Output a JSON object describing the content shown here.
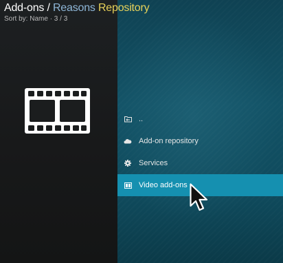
{
  "header": {
    "crumb_addons": "Add-ons",
    "crumb_separator": " / ",
    "crumb_reasons": "Reasons",
    "crumb_repository": " Repository",
    "sort_info": "Sort by: Name  ·  3 / 3"
  },
  "list": {
    "items": [
      {
        "label": "..",
        "icon": "folder-back-icon"
      },
      {
        "label": "Add-on repository",
        "icon": "cloud-icon"
      },
      {
        "label": "Services",
        "icon": "gear-icon"
      },
      {
        "label": "Video add-ons",
        "icon": "film-icon",
        "focused": true
      }
    ]
  },
  "preview": {
    "icon": "film-strip-icon"
  },
  "colors": {
    "accent": "#1590b0",
    "reasons_text": "#8fb7d8",
    "repository_text": "#e8d25a",
    "right_pane": "#125266",
    "left_pane": "#1b1d1e"
  }
}
